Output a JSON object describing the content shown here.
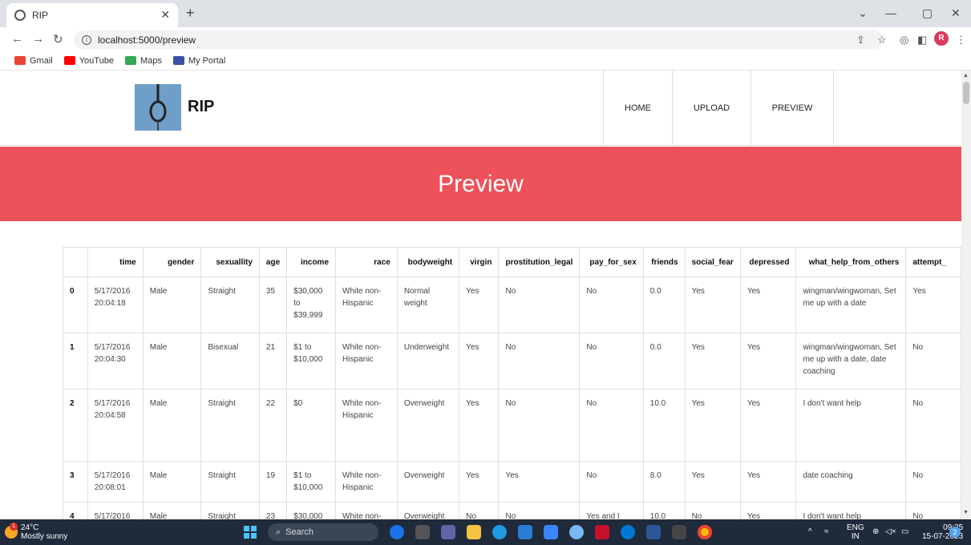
{
  "browser": {
    "tab_title": "RIP",
    "url": "localhost:5000/preview",
    "bookmarks": [
      {
        "label": "Gmail",
        "color": "#ea4335"
      },
      {
        "label": "YouTube",
        "color": "#ff0000"
      },
      {
        "label": "Maps",
        "color": "#34a853"
      },
      {
        "label": "My Portal",
        "color": "#3c4fa8"
      }
    ],
    "avatar": "R"
  },
  "site": {
    "brand": "RIP",
    "nav": [
      "HOME",
      "UPLOAD",
      "PREVIEW"
    ],
    "hero_title": "Preview",
    "hero_color": "#ed5159"
  },
  "table": {
    "columns": [
      "",
      "time",
      "gender",
      "sexuallity",
      "age",
      "income",
      "race",
      "bodyweight",
      "virgin",
      "prostitution_legal",
      "pay_for_sex",
      "friends",
      "social_fear",
      "depressed",
      "what_help_from_others",
      "attempt_"
    ],
    "rows": [
      [
        "0",
        "5/17/2016 20:04:18",
        "Male",
        "Straight",
        "35",
        "$30,000 to $39,999",
        "White non-Hispanic",
        "Normal weight",
        "Yes",
        "No",
        "No",
        "0.0",
        "Yes",
        "Yes",
        "wingman/wingwoman, Set me up with a date",
        "Yes"
      ],
      [
        "1",
        "5/17/2016 20:04:30",
        "Male",
        "Bisexual",
        "21",
        "$1 to $10,000",
        "White non-Hispanic",
        "Underweight",
        "Yes",
        "No",
        "No",
        "0.0",
        "Yes",
        "Yes",
        "wingman/wingwoman, Set me up with a date, date coaching",
        "No"
      ],
      [
        "2",
        "5/17/2016 20:04:58",
        "Male",
        "Straight",
        "22",
        "$0",
        "White non-Hispanic",
        "Overweight",
        "Yes",
        "No",
        "No",
        "10.0",
        "Yes",
        "Yes",
        "I don't want help",
        "No"
      ],
      [
        "3",
        "5/17/2016 20:08:01",
        "Male",
        "Straight",
        "19",
        "$1 to $10,000",
        "White non-Hispanic",
        "Overweight",
        "Yes",
        "Yes",
        "No",
        "8.0",
        "Yes",
        "Yes",
        "date coaching",
        "No"
      ],
      [
        "4",
        "5/17/2016",
        "Male",
        "Straight",
        "23",
        "$30,000",
        "White non-",
        "Overweight",
        "No",
        "No",
        "Yes and I",
        "10.0",
        "No",
        "Yes",
        "I don't want help",
        "No"
      ]
    ]
  },
  "taskbar": {
    "temp": "24°C",
    "weather": "Mostly sunny",
    "weather_badge": "1",
    "search": "Search",
    "lang1": "ENG",
    "lang2": "IN",
    "time": "09:25",
    "date": "15-07-2023",
    "notifications": "2"
  }
}
